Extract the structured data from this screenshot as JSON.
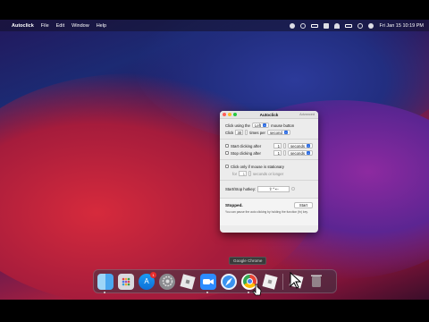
{
  "menubar": {
    "apple_glyph": "",
    "app_name": "Autoclick",
    "items": [
      "File",
      "Edit",
      "Window",
      "Help"
    ],
    "clock": "Fri Jan 15  10:19 PM"
  },
  "window": {
    "title": "Autoclick",
    "advanced_label": "Advanced",
    "click_using_label": "Click using the",
    "mouse_button_value": "Left",
    "mouse_button_label": "mouse button",
    "click_label": "Click",
    "clicks_value": "30",
    "times_per_label": "times per",
    "rate_unit_value": "second",
    "start_after_label": "Start clicking after",
    "start_after_value": "1",
    "start_after_unit": "seconds",
    "stop_after_label": "Stop clicking after",
    "stop_after_value": "1",
    "stop_after_unit": "seconds",
    "stationary_label": "Click only if mouse is stationary",
    "stationary_for_label": "for",
    "stationary_value": "1",
    "stationary_unit": "seconds or longer",
    "hotkey_label": "Start/Stop hotkey:",
    "hotkey_value": "⇧⌃⇠",
    "status": "Stopped.",
    "start_button": "Start",
    "help_text": "You can pause the auto clicking by holding the function (fn) key."
  },
  "tooltip": "Google Chrome",
  "dock": {
    "appstore_badge": "1",
    "icons": [
      "finder-icon",
      "launchpad-icon",
      "app-store-icon",
      "system-preferences-icon",
      "roblox-icon",
      "zoom-icon",
      "safari-icon",
      "chrome-icon",
      "roblox-studio-icon",
      "trash-icon"
    ]
  }
}
